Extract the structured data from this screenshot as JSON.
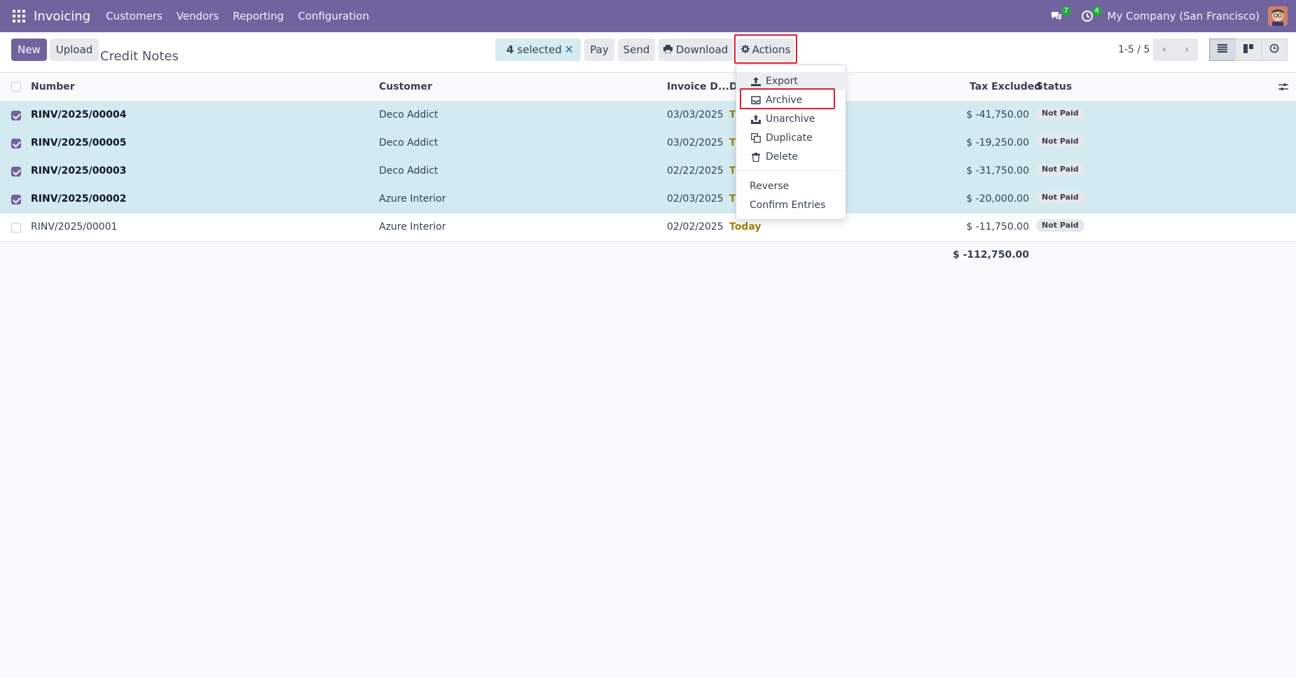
{
  "navbar": {
    "brand": "Invoicing",
    "menu": [
      "Customers",
      "Vendors",
      "Reporting",
      "Configuration"
    ],
    "messages_badge": "7",
    "activities_badge": "4",
    "company": "My Company (San Francisco)"
  },
  "control_panel": {
    "new_label": "New",
    "upload_label": "Upload",
    "title": "Credit Notes",
    "selected_count": "4",
    "selected_label": "selected",
    "pay_label": "Pay",
    "send_label": "Send",
    "download_label": "Download",
    "actions_label": "Actions",
    "pager": "1-5 / 5"
  },
  "table": {
    "headers": {
      "number": "Number",
      "customer": "Customer",
      "invoice_date": "Invoice D...",
      "due": "D",
      "tax_excluded": "Tax Excluded",
      "status": "Status"
    },
    "rows": [
      {
        "number": "RINV/2025/00004",
        "customer": "Deco Addict",
        "date": "03/03/2025",
        "due": "T",
        "amount": "$ -41,750.00",
        "status": "Not Paid",
        "selected": true
      },
      {
        "number": "RINV/2025/00005",
        "customer": "Deco Addict",
        "date": "03/02/2025",
        "due": "T",
        "amount": "$ -19,250.00",
        "status": "Not Paid",
        "selected": true
      },
      {
        "number": "RINV/2025/00003",
        "customer": "Deco Addict",
        "date": "02/22/2025",
        "due": "T",
        "amount": "$ -31,750.00",
        "status": "Not Paid",
        "selected": true
      },
      {
        "number": "RINV/2025/00002",
        "customer": "Azure Interior",
        "date": "02/03/2025",
        "due": "T",
        "amount": "$ -20,000.00",
        "status": "Not Paid",
        "selected": true
      },
      {
        "number": "RINV/2025/00001",
        "customer": "Azure Interior",
        "date": "02/02/2025",
        "due": "Today",
        "amount": "$ -11,750.00",
        "status": "Not Paid",
        "selected": false
      }
    ],
    "total": "$ -112,750.00"
  },
  "actions_menu": {
    "export": "Export",
    "archive": "Archive",
    "unarchive": "Unarchive",
    "duplicate": "Duplicate",
    "delete": "Delete",
    "reverse": "Reverse",
    "confirm_entries": "Confirm Entries"
  },
  "colors": {
    "brand": "#71639e",
    "selected_row": "#d3eaf1",
    "highlight": "#e11d2e",
    "today": "#a57d0a"
  }
}
